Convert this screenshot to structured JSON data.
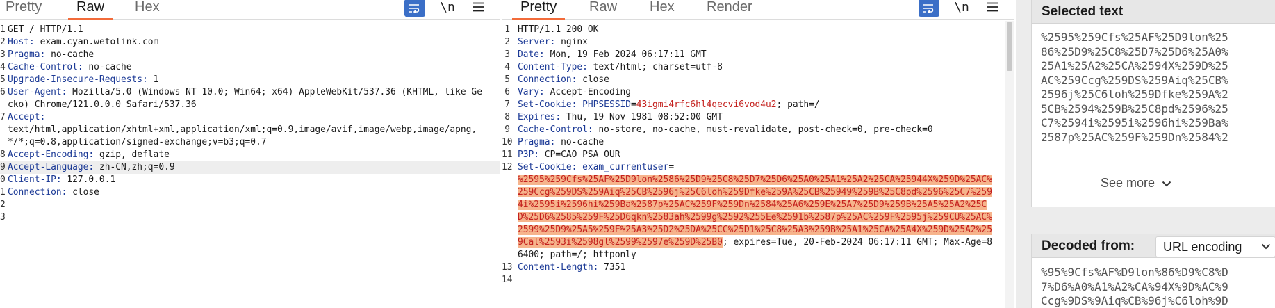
{
  "request": {
    "tabs": [
      "Pretty",
      "Raw",
      "Hex"
    ],
    "active_tab": "Raw",
    "line_numbers": [
      "1",
      "2",
      "3",
      "4",
      "5",
      "6",
      "7",
      "8",
      "9",
      "0",
      "1",
      "2",
      "3"
    ],
    "lines": [
      {
        "value": "GET / HTTP/1.1"
      },
      {
        "key": "Host:",
        "value": " exam.cyan.wetolink.com"
      },
      {
        "key": "Pragma:",
        "value": " no-cache"
      },
      {
        "key": "Cache-Control:",
        "value": " no-cache"
      },
      {
        "key": "Upgrade-Insecure-Requests:",
        "value": " 1"
      },
      {
        "key": "User-Agent:",
        "value": " Mozilla/5.0 (Windows NT 10.0; Win64; x64) AppleWebKit/537.36 (KHTML, like Gecko) Chrome/121.0.0.0 Safari/537.36"
      },
      {
        "key": "Accept:",
        "value": "\ntext/html,application/xhtml+xml,application/xml;q=0.9,image/avif,image/webp,image/apng,*/*;q=0.8,application/signed-exchange;v=b3;q=0.7"
      },
      {
        "key": "Accept-Encoding:",
        "value": " gzip, deflate"
      },
      {
        "key": "Accept-Language:",
        "value": " zh-CN,zh;q=0.9",
        "highlight": true
      },
      {
        "key": "Client-IP:",
        "value": " 127.0.0.1"
      },
      {
        "key": "Connection:",
        "value": " close"
      },
      {
        "value": ""
      },
      {
        "value": ""
      }
    ]
  },
  "response": {
    "tabs": [
      "Pretty",
      "Raw",
      "Hex",
      "Render"
    ],
    "active_tab": "Pretty",
    "lines": [
      {
        "n": "1",
        "value": "HTTP/1.1 200 OK"
      },
      {
        "n": "2",
        "key": "Server:",
        "value": " nginx"
      },
      {
        "n": "3",
        "key": "Date:",
        "value": " Mon, 19 Feb 2024 06:17:11 GMT"
      },
      {
        "n": "4",
        "key": "Content-Type:",
        "value": " text/html; charset=utf-8"
      },
      {
        "n": "5",
        "key": "Connection:",
        "value": " close"
      },
      {
        "n": "6",
        "key": "Vary:",
        "value": " Accept-Encoding"
      },
      {
        "n": "7",
        "key": "Set-Cookie:",
        "ckey": " PHPSESSID",
        "eq": "=",
        "cval": "43igmi4rfc6hl4qecvi6vod4u2",
        "value": "; path=/"
      },
      {
        "n": "8",
        "key": "Expires:",
        "value": " Thu, 19 Nov 1981 08:52:00 GMT"
      },
      {
        "n": "9",
        "key": "Cache-Control:",
        "value": " no-store, no-cache, must-revalidate, post-check=0, pre-check=0"
      },
      {
        "n": "10",
        "key": "Pragma:",
        "value": " no-cache"
      },
      {
        "n": "11",
        "key": "P3P:",
        "value": " CP=CAO PSA OUR"
      },
      {
        "n": "12",
        "key": "Set-Cookie:",
        "ckey": " exam_currentuser",
        "eq": "=",
        "selected": "%2595%259Cfs%25AF%25D9lon%2586%25D9%25C8%25D7%25D6%25A0%25A1%25A2%25CA%25944X%259D%25AC%259Ccg%259DS%259Aiq%25CB%2596j%25C6loh%259Dfke%259A%25CB%25949%259B%25C8pd%2596%25C7%2594i%2595i%2596hi%259Ba%2587p%25AC%259F%259Dn%2584%25A6%259E%25A7%25D9%259B%25A5%25A2%25CD%25D6%2585%259F%25D6qkn%2583ah%2599g%2592%255Ee%2591b%2587p%25AC%259F%2595j%259CU%25AC%2599%25D9%25A5%259F%25A3%25D2%25DA%25CC%25D1%25C8%25A3%259B%25A1%25CA%25A4X%259D%25A2%259Cal%2593i%2598gl%2599%2597e%259D%25B0",
        "value": "; expires=Tue, 20-Feb-2024 06:17:11 GMT; Max-Age=86400; path=/; httponly"
      },
      {
        "n": "13",
        "key": "Content-Length:",
        "value": " 7351"
      },
      {
        "n": "14",
        "value": ""
      }
    ]
  },
  "inspector": {
    "selected_title": "Selected text",
    "selected_lines": [
      "%2595%259Cfs%25AF%25D9lon%25",
      "86%25D9%25C8%25D7%25D6%25A0%",
      "25A1%25A2%25CA%2594X%259D%25",
      "AC%259Ccg%259DS%259Aiq%25CB%",
      "2596j%25C6loh%259Dfke%259A%2",
      "5CB%2594%259B%25C8pd%2596%25",
      "C7%2594i%2595i%2596hi%259Ba%",
      "2587p%25AC%259F%259Dn%2584%2"
    ],
    "see_more": "See more",
    "decoded_title": "Decoded from:",
    "decoded_select": "URL encoding",
    "decoded_lines": [
      "%95%9Cfs%AF%D9lon%86%D9%C8%D",
      "7%D6%A0%A1%A2%CA%94X%9D%AC%9",
      "Ccg%9DS%9Aiq%CB%96j%C6loh%9D"
    ]
  }
}
